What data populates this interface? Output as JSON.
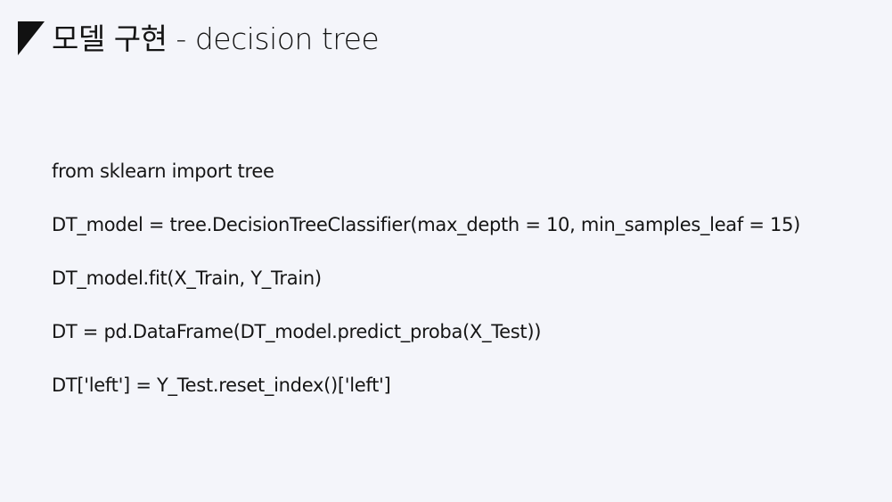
{
  "slide": {
    "title": "모델 구현 - decision tree",
    "code_lines": [
      "from sklearn import tree",
      "DT_model = tree.DecisionTreeClassifier(max_depth = 10, min_samples_leaf = 15)",
      "DT_model.fit(X_Train, Y_Train)",
      "DT = pd.DataFrame(DT_model.predict_proba(X_Test))",
      "DT['left'] = Y_Test.reset_index()['left']"
    ]
  },
  "colors": {
    "background": "#f4f5fa",
    "accent": "#111111"
  },
  "icons": {
    "title_marker": "triangle-corner-icon"
  }
}
